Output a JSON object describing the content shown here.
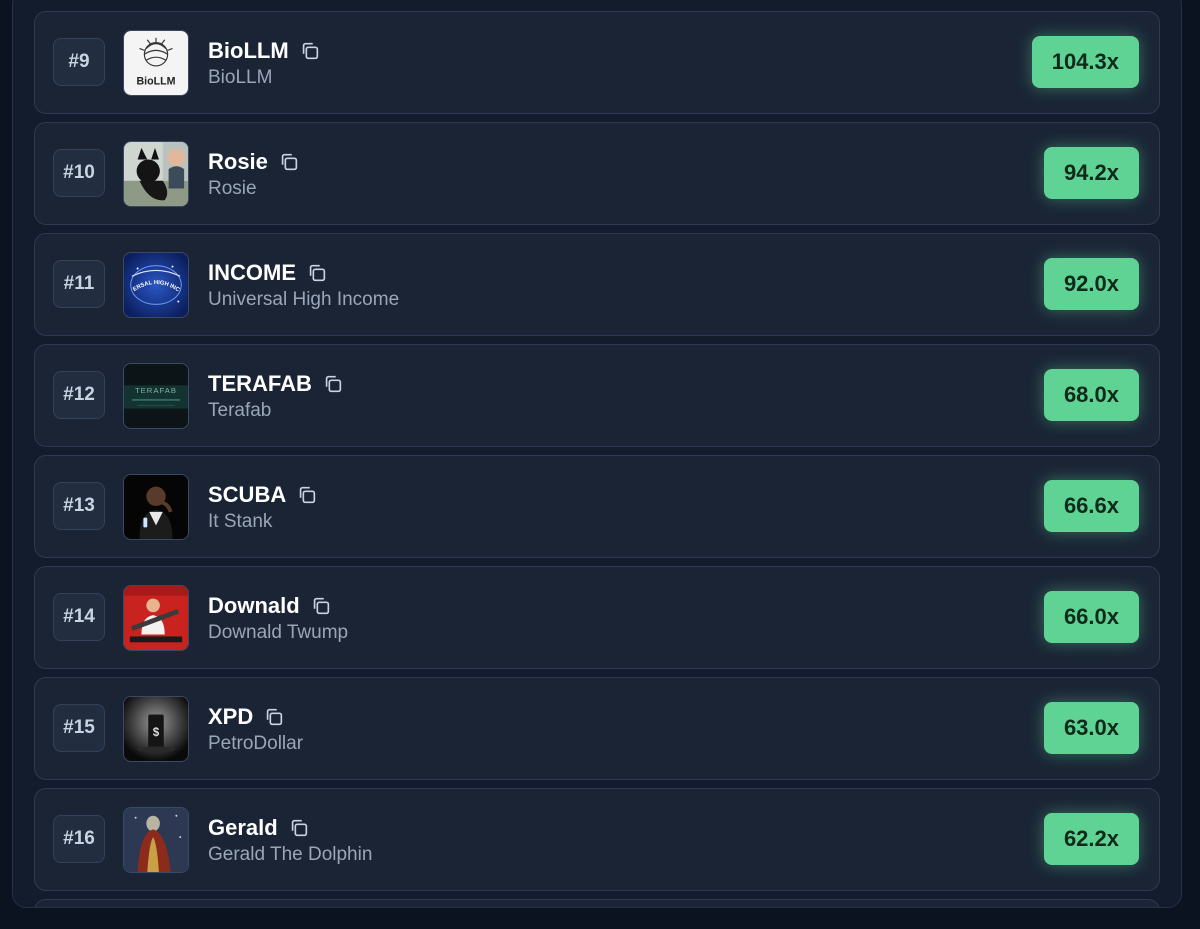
{
  "tokens": [
    {
      "rank": "#9",
      "ticker": "BioLLM",
      "name": "BioLLM",
      "multiplier": "104.3x",
      "avatar_text": "BioLLM"
    },
    {
      "rank": "#10",
      "ticker": "Rosie",
      "name": "Rosie",
      "multiplier": "94.2x"
    },
    {
      "rank": "#11",
      "ticker": "INCOME",
      "name": "Universal High Income",
      "multiplier": "92.0x",
      "avatar_text": "UNIVERSAL HIGH INCOME"
    },
    {
      "rank": "#12",
      "ticker": "TERAFAB",
      "name": "Terafab",
      "multiplier": "68.0x",
      "avatar_text": "TERAFAB"
    },
    {
      "rank": "#13",
      "ticker": "SCUBA",
      "name": "It Stank",
      "multiplier": "66.6x"
    },
    {
      "rank": "#14",
      "ticker": "Downald",
      "name": "Downald Twump",
      "multiplier": "66.0x"
    },
    {
      "rank": "#15",
      "ticker": "XPD",
      "name": "PetroDollar",
      "multiplier": "63.0x"
    },
    {
      "rank": "#16",
      "ticker": "Gerald",
      "name": "Gerald The Dolphin",
      "multiplier": "62.2x"
    }
  ],
  "icons": {
    "copy": "copy-icon"
  },
  "colors": {
    "background": "#0b1220",
    "panel": "#131c2c",
    "row": "#1a2435",
    "multiplier_badge": "#5fd394",
    "ticker_text": "#ffffff",
    "name_text": "#9aa6b8"
  }
}
